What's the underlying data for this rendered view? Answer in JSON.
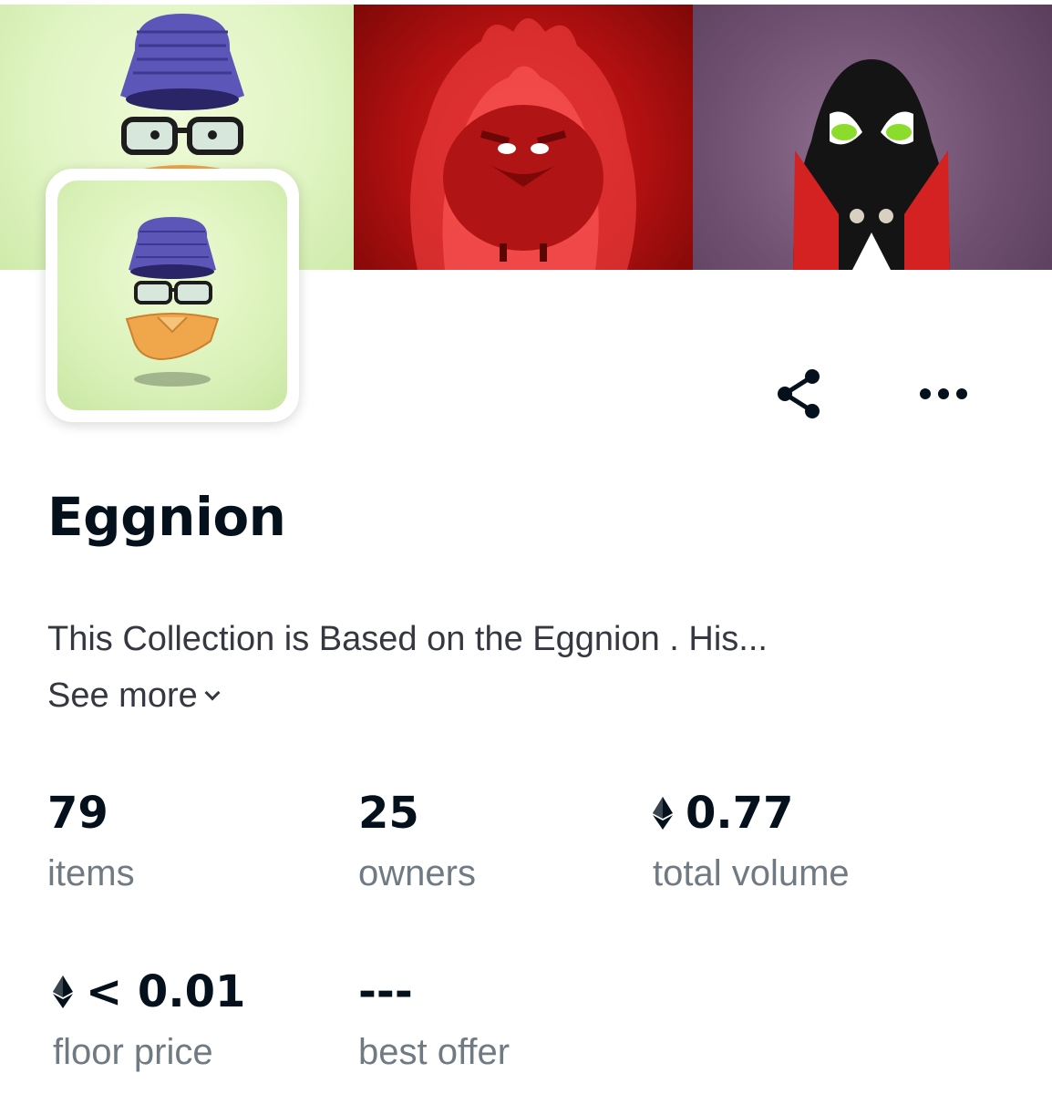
{
  "collection": {
    "name": "Eggnion",
    "description": "This Collection is Based on the Eggnion . His...",
    "see_more_label": "See more"
  },
  "stats": [
    {
      "value": "79",
      "label": "items",
      "currency": ""
    },
    {
      "value": "25",
      "label": "owners",
      "currency": ""
    },
    {
      "value": "0.77",
      "label": "total volume",
      "currency": "eth"
    },
    {
      "value": "< 0.01",
      "label": "floor price",
      "currency": "eth"
    },
    {
      "value": "---",
      "label": "best offer",
      "currency": ""
    }
  ],
  "icons": {
    "share": "share-icon",
    "more": "more-options-icon",
    "currency": "ethereum-icon",
    "see_more": "chevron-down-icon"
  },
  "colors": {
    "text_primary": "#04111d",
    "text_secondary": "#707a83",
    "text_body": "#353840"
  }
}
